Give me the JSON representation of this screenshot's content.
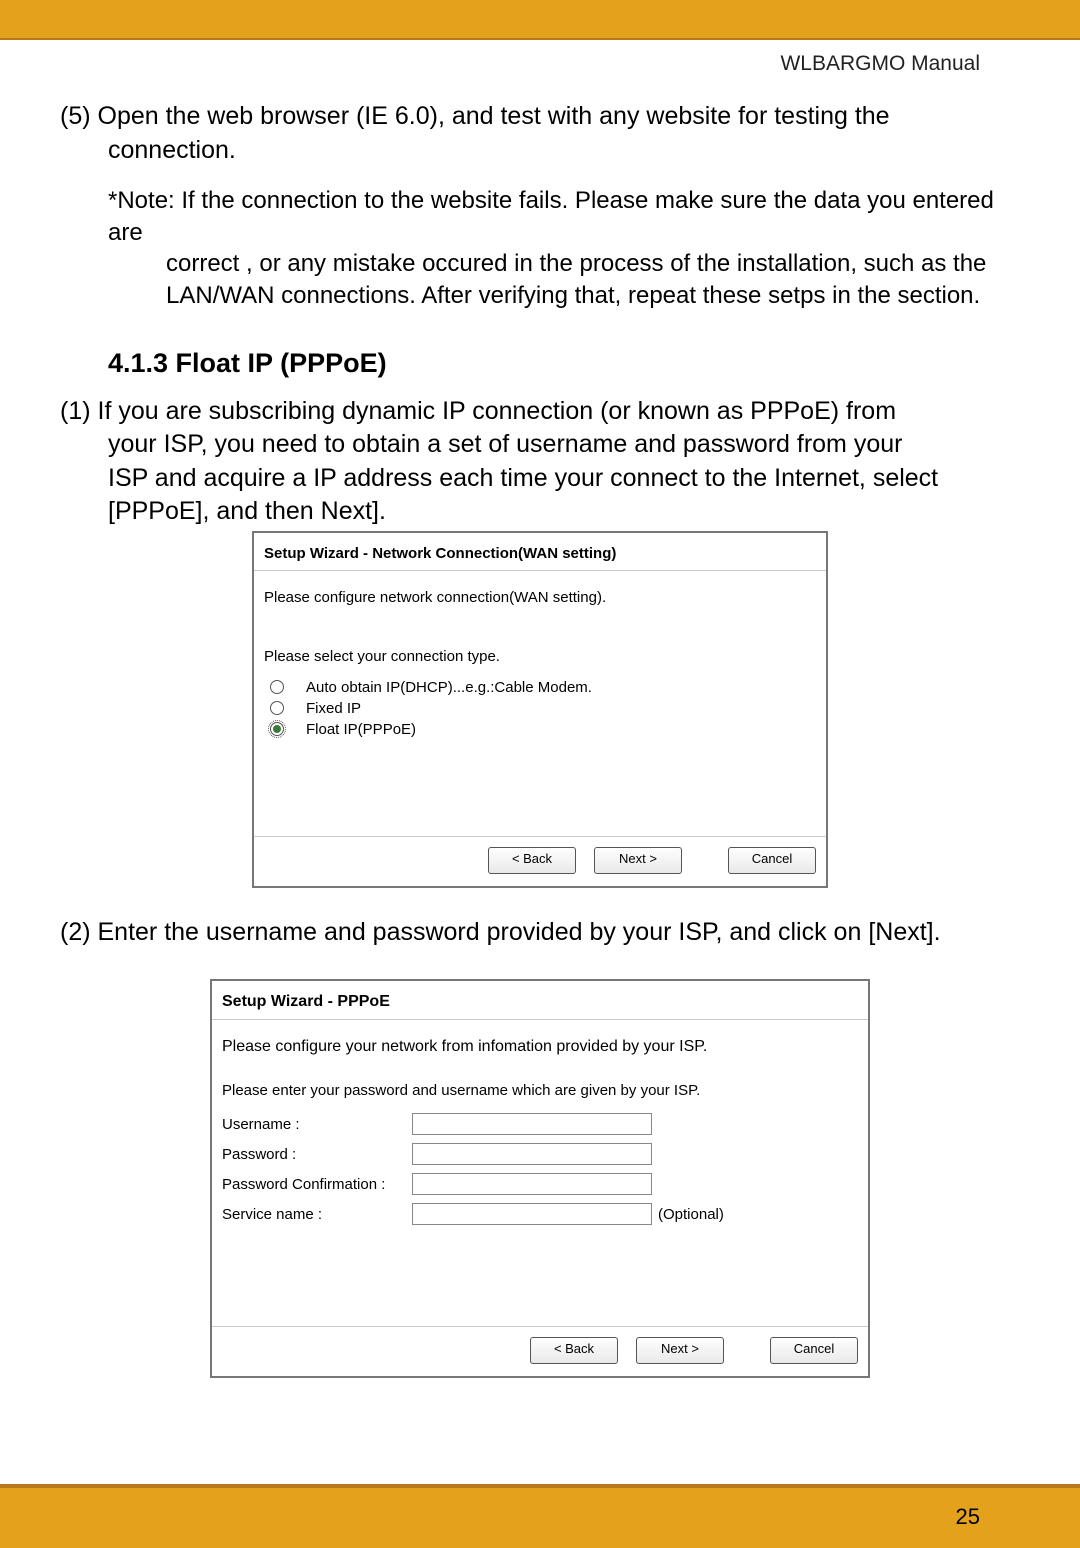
{
  "header": {
    "manual_label": "WLBARGMO Manual"
  },
  "step5": {
    "line1": "(5) Open the web browser (IE 6.0), and test with any website for testing the",
    "line2": "connection."
  },
  "note": {
    "line1": "*Note: If the connection to the website fails. Please make sure the data you entered are",
    "line2": "correct , or any mistake occured in the process of the installation, such as the",
    "line3": "LAN/WAN connections. After verifying that, repeat these setps in the section."
  },
  "section_413": {
    "heading": "4.1.3 Float IP (PPPoE)"
  },
  "step_413_1": {
    "line1": "(1) If you are subscribing dynamic IP connection (or known as PPPoE) from",
    "line2": "your ISP, you need to obtain a set of username and password from your",
    "line3": "ISP and acquire a IP address each time your connect to the Internet, select",
    "line4": "[PPPoE], and then Next]."
  },
  "wizard1": {
    "title": "Setup Wizard - Network Connection(WAN setting)",
    "subtitle": "Please configure network connection(WAN setting).",
    "prompt": "Please select your connection type.",
    "options": [
      "Auto obtain IP(DHCP)...e.g.:Cable Modem.",
      "Fixed IP",
      "Float IP(PPPoE)"
    ],
    "buttons": {
      "back": "< Back",
      "next": "Next >",
      "cancel": "Cancel"
    }
  },
  "step_413_2": {
    "text": "(2) Enter the username and password provided by your ISP, and click on [Next]."
  },
  "wizard2": {
    "title": "Setup Wizard - PPPoE",
    "subtitle": "Please configure your network from infomation provided by your ISP.",
    "prompt": "Please enter your password and username which are given by your ISP.",
    "fields": {
      "username": "Username :",
      "password": "Password :",
      "password_confirm": "Password Confirmation :",
      "service_name": "Service name :",
      "optional": "(Optional)"
    },
    "buttons": {
      "back": "< Back",
      "next": "Next >",
      "cancel": "Cancel"
    }
  },
  "page_number": "25"
}
